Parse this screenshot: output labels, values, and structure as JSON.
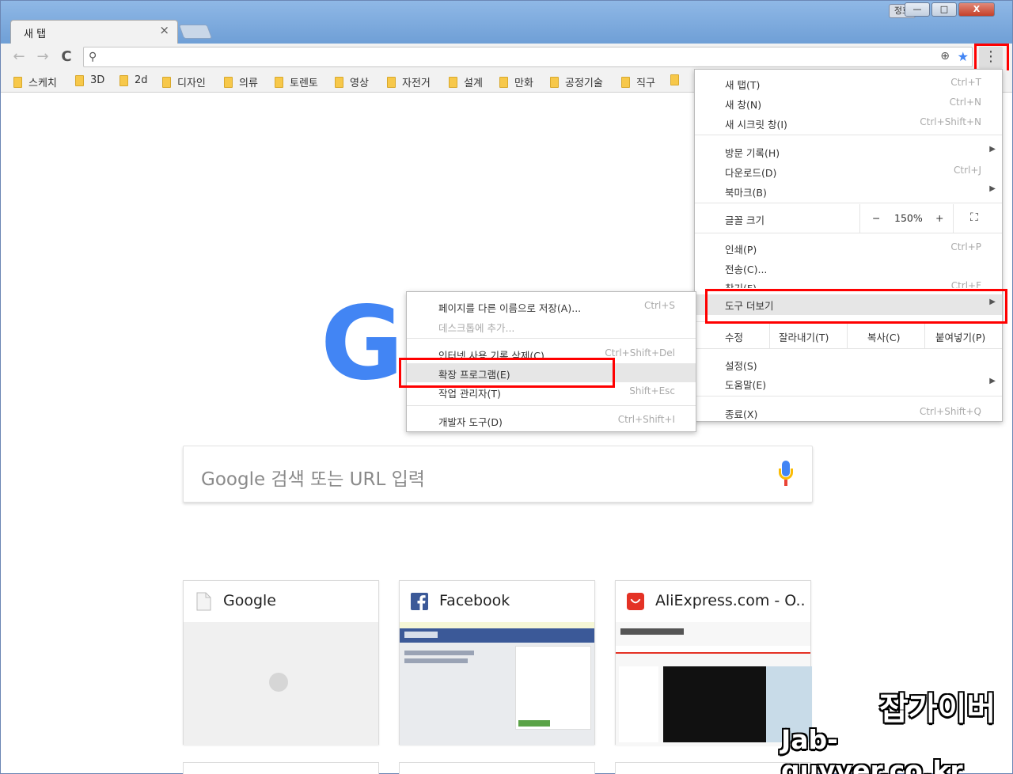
{
  "window": {
    "tab_title": "새 탭",
    "tab_close": "×",
    "user_badge": "정호",
    "minimize": "—",
    "maximize": "□",
    "close": "X"
  },
  "toolbar": {
    "back_icon": "←",
    "forward_icon": "→",
    "reload_icon": "C",
    "search_icon": "⚲",
    "zoom_icon": "⊕",
    "star_icon": "★",
    "menu_icon": "⋮"
  },
  "bookmarks": [
    "스케치",
    "3D",
    "2d",
    "디자인",
    "의류",
    "토렌토",
    "영상",
    "자전거",
    "설계",
    "만화",
    "공정기술",
    "직구"
  ],
  "content": {
    "google_letter": "G",
    "search_placeholder": "Google 검색 또는 URL 입력",
    "tiles": [
      {
        "title": "Google",
        "icon": "page-icon"
      },
      {
        "title": "Facebook",
        "icon": "facebook-icon"
      },
      {
        "title": "AliExpress.com - O...",
        "icon": "aliexpress-icon"
      }
    ]
  },
  "menu": {
    "new_tab": "새 탭(T)",
    "new_tab_sc": "Ctrl+T",
    "new_window": "새 창(N)",
    "new_window_sc": "Ctrl+N",
    "incognito": "새 시크릿 창(I)",
    "incognito_sc": "Ctrl+Shift+N",
    "history": "방문 기록(H)",
    "downloads": "다운로드(D)",
    "downloads_sc": "Ctrl+J",
    "bookmarks": "북마크(B)",
    "zoom_label": "글꼴 크기",
    "zoom_minus": "−",
    "zoom_value": "150%",
    "zoom_plus": "+",
    "fullscreen": "⛶",
    "print": "인쇄(P)",
    "print_sc": "Ctrl+P",
    "cast": "전송(C)...",
    "find": "찾기(F)",
    "find_sc": "Ctrl+F",
    "more_tools": "도구 더보기",
    "edit_label": "수정",
    "cut": "잘라내기(T)",
    "copy": "복사(C)",
    "paste": "붙여넣기(P)",
    "settings": "설정(S)",
    "help": "도움말(E)",
    "exit": "종료(X)",
    "exit_sc": "Ctrl+Shift+Q",
    "arrow": "▶"
  },
  "submenu": {
    "save_page": "페이지를 다른 이름으로 저장(A)...",
    "save_page_sc": "Ctrl+S",
    "add_desktop": "데스크톱에 추가...",
    "clear_data": "인터넷 사용 기록 삭제(C)...",
    "clear_data_sc": "Ctrl+Shift+Del",
    "extensions": "확장 프로그램(E)",
    "task_manager": "작업 관리자(T)",
    "task_manager_sc": "Shift+Esc",
    "devtools": "개발자 도구(D)",
    "devtools_sc": "Ctrl+Shift+I"
  },
  "watermark": {
    "line1": "잡가이버",
    "line2": "Jab-guyver.co.kr"
  },
  "colors": {
    "highlight": "#ff0000",
    "google_blue": "#4285f4",
    "titlebar": "#78a8dd"
  }
}
